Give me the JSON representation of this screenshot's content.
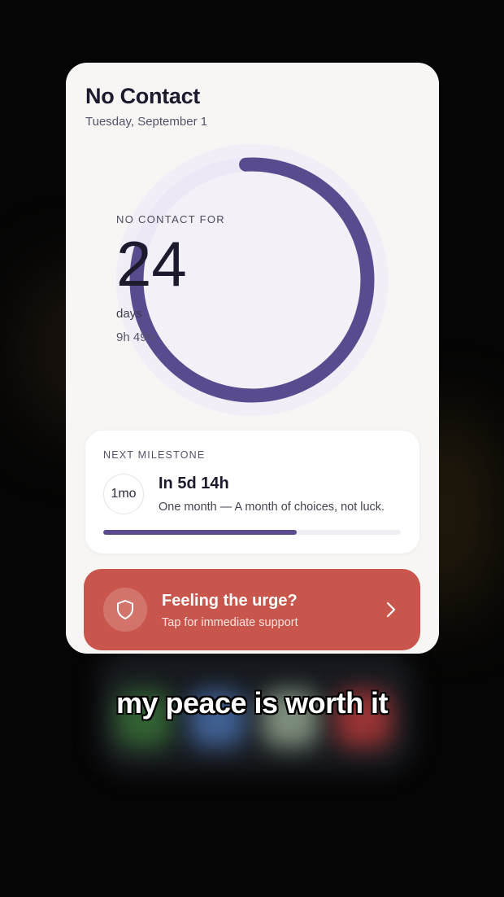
{
  "screen": {
    "title": "No Contact",
    "date": "Tuesday, September 1"
  },
  "counter": {
    "caption": "NO CONTACT FOR",
    "value": "24",
    "unit": "days",
    "sub": "9h 49m",
    "progress_fraction": 0.8
  },
  "milestone": {
    "label": "NEXT MILESTONE",
    "badge": "1mo",
    "title": "In 5d 14h",
    "description": "One month — A month of choices, not luck.",
    "progress_percent": 65
  },
  "urge": {
    "title": "Feeling the urge?",
    "subtitle": "Tap for immediate support",
    "icon": "shield-icon",
    "chevron": "chevron-right-icon"
  },
  "overlay_caption": "my peace is worth it",
  "colors": {
    "accent": "#5a4a8e",
    "ring_track": "#efecf7",
    "urge_bg": "#c8564c",
    "card_bg": "#f8f6f4"
  }
}
